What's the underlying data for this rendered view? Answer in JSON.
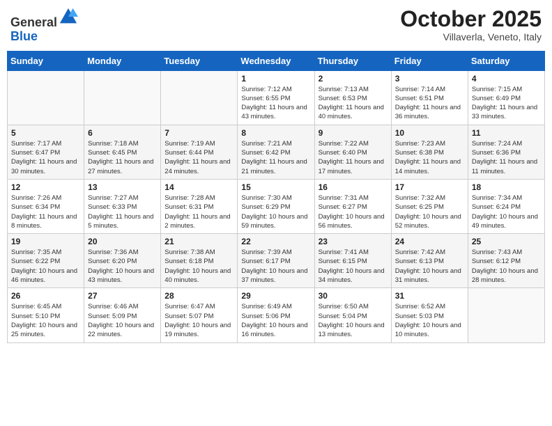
{
  "header": {
    "logo_general": "General",
    "logo_blue": "Blue",
    "month_title": "October 2025",
    "subtitle": "Villaverla, Veneto, Italy"
  },
  "days_of_week": [
    "Sunday",
    "Monday",
    "Tuesday",
    "Wednesday",
    "Thursday",
    "Friday",
    "Saturday"
  ],
  "weeks": [
    [
      {
        "day": "",
        "info": ""
      },
      {
        "day": "",
        "info": ""
      },
      {
        "day": "",
        "info": ""
      },
      {
        "day": "1",
        "info": "Sunrise: 7:12 AM\nSunset: 6:55 PM\nDaylight: 11 hours and 43 minutes."
      },
      {
        "day": "2",
        "info": "Sunrise: 7:13 AM\nSunset: 6:53 PM\nDaylight: 11 hours and 40 minutes."
      },
      {
        "day": "3",
        "info": "Sunrise: 7:14 AM\nSunset: 6:51 PM\nDaylight: 11 hours and 36 minutes."
      },
      {
        "day": "4",
        "info": "Sunrise: 7:15 AM\nSunset: 6:49 PM\nDaylight: 11 hours and 33 minutes."
      }
    ],
    [
      {
        "day": "5",
        "info": "Sunrise: 7:17 AM\nSunset: 6:47 PM\nDaylight: 11 hours and 30 minutes."
      },
      {
        "day": "6",
        "info": "Sunrise: 7:18 AM\nSunset: 6:45 PM\nDaylight: 11 hours and 27 minutes."
      },
      {
        "day": "7",
        "info": "Sunrise: 7:19 AM\nSunset: 6:44 PM\nDaylight: 11 hours and 24 minutes."
      },
      {
        "day": "8",
        "info": "Sunrise: 7:21 AM\nSunset: 6:42 PM\nDaylight: 11 hours and 21 minutes."
      },
      {
        "day": "9",
        "info": "Sunrise: 7:22 AM\nSunset: 6:40 PM\nDaylight: 11 hours and 17 minutes."
      },
      {
        "day": "10",
        "info": "Sunrise: 7:23 AM\nSunset: 6:38 PM\nDaylight: 11 hours and 14 minutes."
      },
      {
        "day": "11",
        "info": "Sunrise: 7:24 AM\nSunset: 6:36 PM\nDaylight: 11 hours and 11 minutes."
      }
    ],
    [
      {
        "day": "12",
        "info": "Sunrise: 7:26 AM\nSunset: 6:34 PM\nDaylight: 11 hours and 8 minutes."
      },
      {
        "day": "13",
        "info": "Sunrise: 7:27 AM\nSunset: 6:33 PM\nDaylight: 11 hours and 5 minutes."
      },
      {
        "day": "14",
        "info": "Sunrise: 7:28 AM\nSunset: 6:31 PM\nDaylight: 11 hours and 2 minutes."
      },
      {
        "day": "15",
        "info": "Sunrise: 7:30 AM\nSunset: 6:29 PM\nDaylight: 10 hours and 59 minutes."
      },
      {
        "day": "16",
        "info": "Sunrise: 7:31 AM\nSunset: 6:27 PM\nDaylight: 10 hours and 56 minutes."
      },
      {
        "day": "17",
        "info": "Sunrise: 7:32 AM\nSunset: 6:25 PM\nDaylight: 10 hours and 52 minutes."
      },
      {
        "day": "18",
        "info": "Sunrise: 7:34 AM\nSunset: 6:24 PM\nDaylight: 10 hours and 49 minutes."
      }
    ],
    [
      {
        "day": "19",
        "info": "Sunrise: 7:35 AM\nSunset: 6:22 PM\nDaylight: 10 hours and 46 minutes."
      },
      {
        "day": "20",
        "info": "Sunrise: 7:36 AM\nSunset: 6:20 PM\nDaylight: 10 hours and 43 minutes."
      },
      {
        "day": "21",
        "info": "Sunrise: 7:38 AM\nSunset: 6:18 PM\nDaylight: 10 hours and 40 minutes."
      },
      {
        "day": "22",
        "info": "Sunrise: 7:39 AM\nSunset: 6:17 PM\nDaylight: 10 hours and 37 minutes."
      },
      {
        "day": "23",
        "info": "Sunrise: 7:41 AM\nSunset: 6:15 PM\nDaylight: 10 hours and 34 minutes."
      },
      {
        "day": "24",
        "info": "Sunrise: 7:42 AM\nSunset: 6:13 PM\nDaylight: 10 hours and 31 minutes."
      },
      {
        "day": "25",
        "info": "Sunrise: 7:43 AM\nSunset: 6:12 PM\nDaylight: 10 hours and 28 minutes."
      }
    ],
    [
      {
        "day": "26",
        "info": "Sunrise: 6:45 AM\nSunset: 5:10 PM\nDaylight: 10 hours and 25 minutes."
      },
      {
        "day": "27",
        "info": "Sunrise: 6:46 AM\nSunset: 5:09 PM\nDaylight: 10 hours and 22 minutes."
      },
      {
        "day": "28",
        "info": "Sunrise: 6:47 AM\nSunset: 5:07 PM\nDaylight: 10 hours and 19 minutes."
      },
      {
        "day": "29",
        "info": "Sunrise: 6:49 AM\nSunset: 5:06 PM\nDaylight: 10 hours and 16 minutes."
      },
      {
        "day": "30",
        "info": "Sunrise: 6:50 AM\nSunset: 5:04 PM\nDaylight: 10 hours and 13 minutes."
      },
      {
        "day": "31",
        "info": "Sunrise: 6:52 AM\nSunset: 5:03 PM\nDaylight: 10 hours and 10 minutes."
      },
      {
        "day": "",
        "info": ""
      }
    ]
  ],
  "colors": {
    "header_bg": "#1565c0",
    "header_text": "#ffffff",
    "border": "#cccccc",
    "row_even": "#f5f5f5",
    "row_odd": "#ffffff"
  }
}
